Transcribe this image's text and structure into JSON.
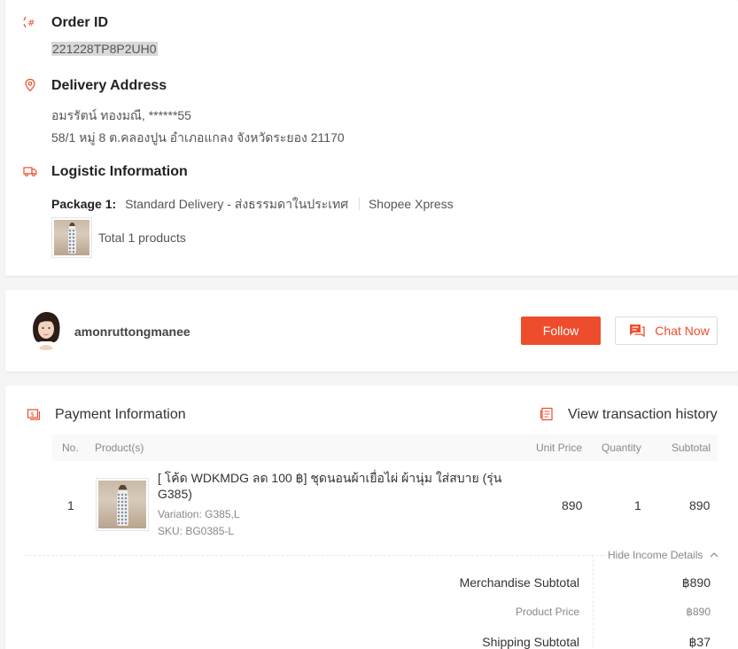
{
  "order": {
    "title": "Order ID",
    "id": "221228TP8P2UH0"
  },
  "delivery": {
    "title": "Delivery Address",
    "name_line": "อมรรัตน์ ทองมณี, ******55",
    "address_line": "58/1 หมู่ 8 ต.คลองปูน อำเภอแกลง จังหวัดระยอง 21170"
  },
  "logistic": {
    "title": "Logistic Information",
    "package_label": "Package 1:",
    "service": "Standard Delivery - ส่งธรรมดาในประเทศ",
    "carrier": "Shopee Xpress",
    "total_products": "Total 1 products"
  },
  "buyer": {
    "username": "amonruttongmanee",
    "follow_label": "Follow",
    "chat_label": "Chat Now"
  },
  "payment": {
    "title": "Payment Information",
    "history_link": "View transaction history",
    "columns": {
      "no": "No.",
      "product": "Product(s)",
      "unit_price": "Unit Price",
      "quantity": "Quantity",
      "subtotal": "Subtotal"
    },
    "rows": [
      {
        "no": "1",
        "name": "[ โค้ด WDKMDG ลด 100 ฿] ชุดนอนผ้าเยื่อไผ่ ผ้านุ่ม ใส่สบาย (รุ่น G385)",
        "variation": "Variation: G385,L",
        "sku": "SKU: BG0385-L",
        "unit_price": "890",
        "quantity": "1",
        "subtotal": "890"
      }
    ],
    "hide_income_label": "Hide Income Details",
    "summary": {
      "merch_label": "Merchandise Subtotal",
      "merch_value": "฿890",
      "product_price_label": "Product Price",
      "product_price_value": "฿890",
      "shipping_label": "Shipping Subtotal",
      "shipping_value": "฿37"
    }
  },
  "colors": {
    "accent": "#ee4d2d",
    "text": "#333333",
    "muted": "#888888"
  }
}
